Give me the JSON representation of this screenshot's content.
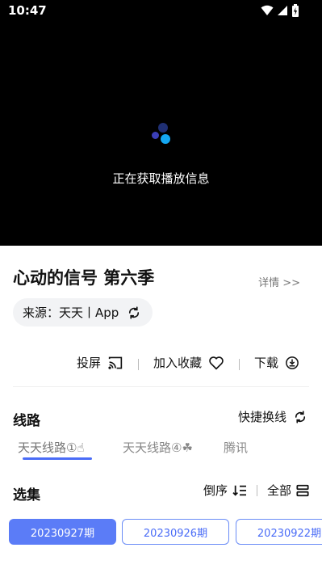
{
  "status": {
    "time": "10:47"
  },
  "player": {
    "loading_text": "正在获取播放信息"
  },
  "show": {
    "title": "心动的信号 第六季",
    "detail_link": "详情 >>",
    "source_label": "来源：天天丨App"
  },
  "actions": {
    "cast_label": "投屏",
    "favorite_label": "加入收藏",
    "download_label": "下载"
  },
  "lines_section": {
    "title": "线路",
    "quick_switch_label": "快捷换线",
    "items": [
      {
        "label": "天天线路①☝"
      },
      {
        "label": "天天线路④☘"
      },
      {
        "label": "腾讯"
      }
    ]
  },
  "episodes_section": {
    "title": "选集",
    "order_label": "倒序",
    "all_label": "全部",
    "items": [
      {
        "label": "20230927期",
        "selected": true
      },
      {
        "label": "20230926期",
        "selected": false
      },
      {
        "label": "20230922期",
        "selected": false
      }
    ]
  },
  "colors": {
    "accent": "#4a6cf7",
    "selected_episode_bg": "#5b7cf7",
    "player_bg": "#000000"
  }
}
